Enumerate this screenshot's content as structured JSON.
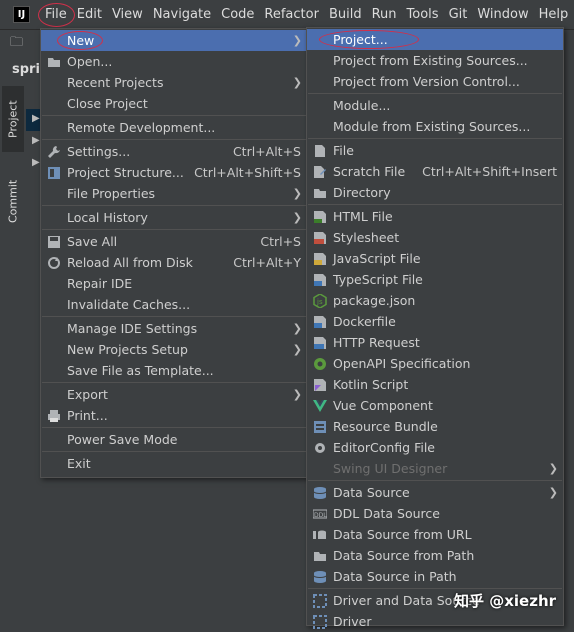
{
  "app": {
    "logo_text": "IJ"
  },
  "menubar": [
    "File",
    "Edit",
    "View",
    "Navigate",
    "Code",
    "Refactor",
    "Build",
    "Run",
    "Tools",
    "Git",
    "Window",
    "Help"
  ],
  "background": {
    "project_label": "sprin",
    "tabs": [
      "Project",
      "Commit"
    ]
  },
  "file_menu": {
    "items": [
      {
        "label": "New",
        "shortcut": "",
        "arrow": true,
        "icon": "",
        "highlighted": true
      },
      {
        "label": "Open...",
        "shortcut": "",
        "arrow": false,
        "icon": "folder-icon"
      },
      {
        "label": "Recent Projects",
        "shortcut": "",
        "arrow": true,
        "icon": ""
      },
      {
        "label": "Close Project",
        "shortcut": "",
        "arrow": false,
        "icon": ""
      },
      {
        "label": "Remote Development...",
        "shortcut": "",
        "arrow": false,
        "icon": ""
      },
      {
        "label": "Settings...",
        "shortcut": "Ctrl+Alt+S",
        "arrow": false,
        "icon": "wrench-icon"
      },
      {
        "label": "Project Structure...",
        "shortcut": "Ctrl+Alt+Shift+S",
        "arrow": false,
        "icon": "structure-icon"
      },
      {
        "label": "File Properties",
        "shortcut": "",
        "arrow": true,
        "icon": ""
      },
      {
        "label": "Local History",
        "shortcut": "",
        "arrow": true,
        "icon": ""
      },
      {
        "label": "Save All",
        "shortcut": "Ctrl+S",
        "arrow": false,
        "icon": "save-icon"
      },
      {
        "label": "Reload All from Disk",
        "shortcut": "Ctrl+Alt+Y",
        "arrow": false,
        "icon": "reload-icon"
      },
      {
        "label": "Repair IDE",
        "shortcut": "",
        "arrow": false,
        "icon": ""
      },
      {
        "label": "Invalidate Caches...",
        "shortcut": "",
        "arrow": false,
        "icon": ""
      },
      {
        "label": "Manage IDE Settings",
        "shortcut": "",
        "arrow": true,
        "icon": ""
      },
      {
        "label": "New Projects Setup",
        "shortcut": "",
        "arrow": true,
        "icon": ""
      },
      {
        "label": "Save File as Template...",
        "shortcut": "",
        "arrow": false,
        "icon": ""
      },
      {
        "label": "Export",
        "shortcut": "",
        "arrow": true,
        "icon": ""
      },
      {
        "label": "Print...",
        "shortcut": "",
        "arrow": false,
        "icon": "print-icon"
      },
      {
        "label": "Power Save Mode",
        "shortcut": "",
        "arrow": false,
        "icon": ""
      },
      {
        "label": "Exit",
        "shortcut": "",
        "arrow": false,
        "icon": ""
      }
    ]
  },
  "new_submenu": {
    "items": [
      {
        "label": "Project...",
        "shortcut": "",
        "arrow": false,
        "icon": "",
        "highlighted": true
      },
      {
        "label": "Project from Existing Sources...",
        "shortcut": "",
        "arrow": false,
        "icon": ""
      },
      {
        "label": "Project from Version Control...",
        "shortcut": "",
        "arrow": false,
        "icon": ""
      },
      {
        "label": "Module...",
        "shortcut": "",
        "arrow": false,
        "icon": ""
      },
      {
        "label": "Module from Existing Sources...",
        "shortcut": "",
        "arrow": false,
        "icon": ""
      },
      {
        "label": "File",
        "shortcut": "",
        "arrow": false,
        "icon": "file-icon"
      },
      {
        "label": "Scratch File",
        "shortcut": "Ctrl+Alt+Shift+Insert",
        "arrow": false,
        "icon": "scratch-file-icon"
      },
      {
        "label": "Directory",
        "shortcut": "",
        "arrow": false,
        "icon": "directory-icon"
      },
      {
        "label": "HTML File",
        "shortcut": "",
        "arrow": false,
        "icon": "html-icon"
      },
      {
        "label": "Stylesheet",
        "shortcut": "",
        "arrow": false,
        "icon": "css-icon"
      },
      {
        "label": "JavaScript File",
        "shortcut": "",
        "arrow": false,
        "icon": "javascript-icon"
      },
      {
        "label": "TypeScript File",
        "shortcut": "",
        "arrow": false,
        "icon": "typescript-icon"
      },
      {
        "label": "package.json",
        "shortcut": "",
        "arrow": false,
        "icon": "nodejs-icon"
      },
      {
        "label": "Dockerfile",
        "shortcut": "",
        "arrow": false,
        "icon": "docker-icon"
      },
      {
        "label": "HTTP Request",
        "shortcut": "",
        "arrow": false,
        "icon": "api-icon"
      },
      {
        "label": "OpenAPI Specification",
        "shortcut": "",
        "arrow": false,
        "icon": "openapi-icon"
      },
      {
        "label": "Kotlin Script",
        "shortcut": "",
        "arrow": false,
        "icon": "kotlin-icon"
      },
      {
        "label": "Vue Component",
        "shortcut": "",
        "arrow": false,
        "icon": "vue-icon"
      },
      {
        "label": "Resource Bundle",
        "shortcut": "",
        "arrow": false,
        "icon": "resource-bundle-icon"
      },
      {
        "label": "EditorConfig File",
        "shortcut": "",
        "arrow": false,
        "icon": "gear-icon"
      },
      {
        "label": "Swing UI Designer",
        "shortcut": "",
        "arrow": true,
        "icon": "",
        "disabled": true
      },
      {
        "label": "Data Source",
        "shortcut": "",
        "arrow": true,
        "icon": "database-icon"
      },
      {
        "label": "DDL Data Source",
        "shortcut": "",
        "arrow": false,
        "icon": "ddl-icon"
      },
      {
        "label": "Data Source from URL",
        "shortcut": "",
        "arrow": false,
        "icon": "url-icon"
      },
      {
        "label": "Data Source from Path",
        "shortcut": "",
        "arrow": false,
        "icon": "folder-icon"
      },
      {
        "label": "Data Source in Path",
        "shortcut": "",
        "arrow": false,
        "icon": "database-icon"
      },
      {
        "label": "Driver and Data Source",
        "shortcut": "",
        "arrow": false,
        "icon": "driver-icon"
      },
      {
        "label": "Driver",
        "shortcut": "",
        "arrow": false,
        "icon": "driver-icon"
      }
    ]
  },
  "watermark": "知乎 @xiezhr",
  "colors": {
    "highlight": "#4b6eaf",
    "annotation": "#d0304a",
    "menu_bg": "#3c3f41"
  }
}
